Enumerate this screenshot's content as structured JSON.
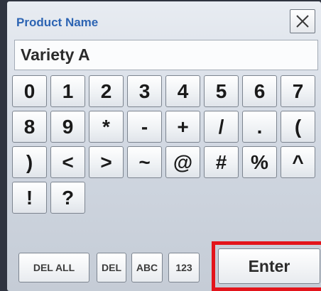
{
  "title": "Product Name",
  "close_icon": "close-icon",
  "name_field": {
    "value": "Variety A"
  },
  "keypad": {
    "rows": [
      [
        "0",
        "1",
        "2",
        "3",
        "4",
        "5",
        "6",
        "7"
      ],
      [
        "8",
        "9",
        "*",
        "-",
        "+",
        "/",
        ".",
        "("
      ],
      [
        ")",
        "<",
        ">",
        "~",
        "@",
        "#",
        "%",
        "^"
      ],
      [
        "!",
        "?"
      ]
    ]
  },
  "buttons": {
    "del_all": "DEL ALL",
    "del": "DEL",
    "abc": "ABC",
    "num": "123",
    "enter": "Enter"
  },
  "colors": {
    "title": "#2d64b3",
    "highlight": "#e3141b"
  }
}
